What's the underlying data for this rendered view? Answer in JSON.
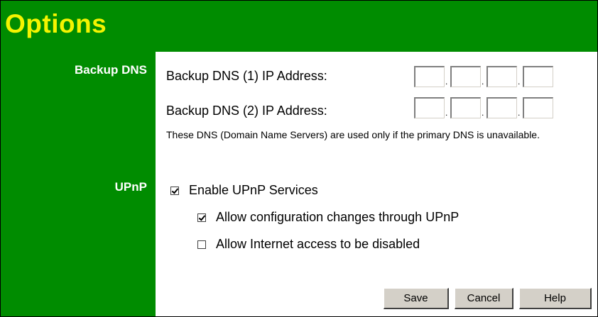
{
  "header": {
    "title": "Options"
  },
  "backup_dns": {
    "section_label": "Backup DNS",
    "dns1_label": "Backup DNS (1) IP Address:",
    "dns2_label": "Backup DNS (2) IP Address:",
    "note": "These DNS (Domain Name Servers) are used only if the primary DNS is unavailable.",
    "dns1_octets": [
      "",
      "",
      "",
      ""
    ],
    "dns2_octets": [
      "",
      "",
      "",
      ""
    ],
    "separator": "."
  },
  "upnp": {
    "section_label": "UPnP",
    "options": [
      {
        "label": "Enable UPnP Services",
        "checked": true
      },
      {
        "label": "Allow configuration changes through UPnP",
        "checked": true
      },
      {
        "label": "Allow Internet access to be disabled",
        "checked": false
      }
    ]
  },
  "buttons": {
    "save": "Save",
    "cancel": "Cancel",
    "help": "Help"
  },
  "colors": {
    "background": "#008c00",
    "title": "#f4f400",
    "label": "#ffffff",
    "panel": "#ffffff"
  }
}
